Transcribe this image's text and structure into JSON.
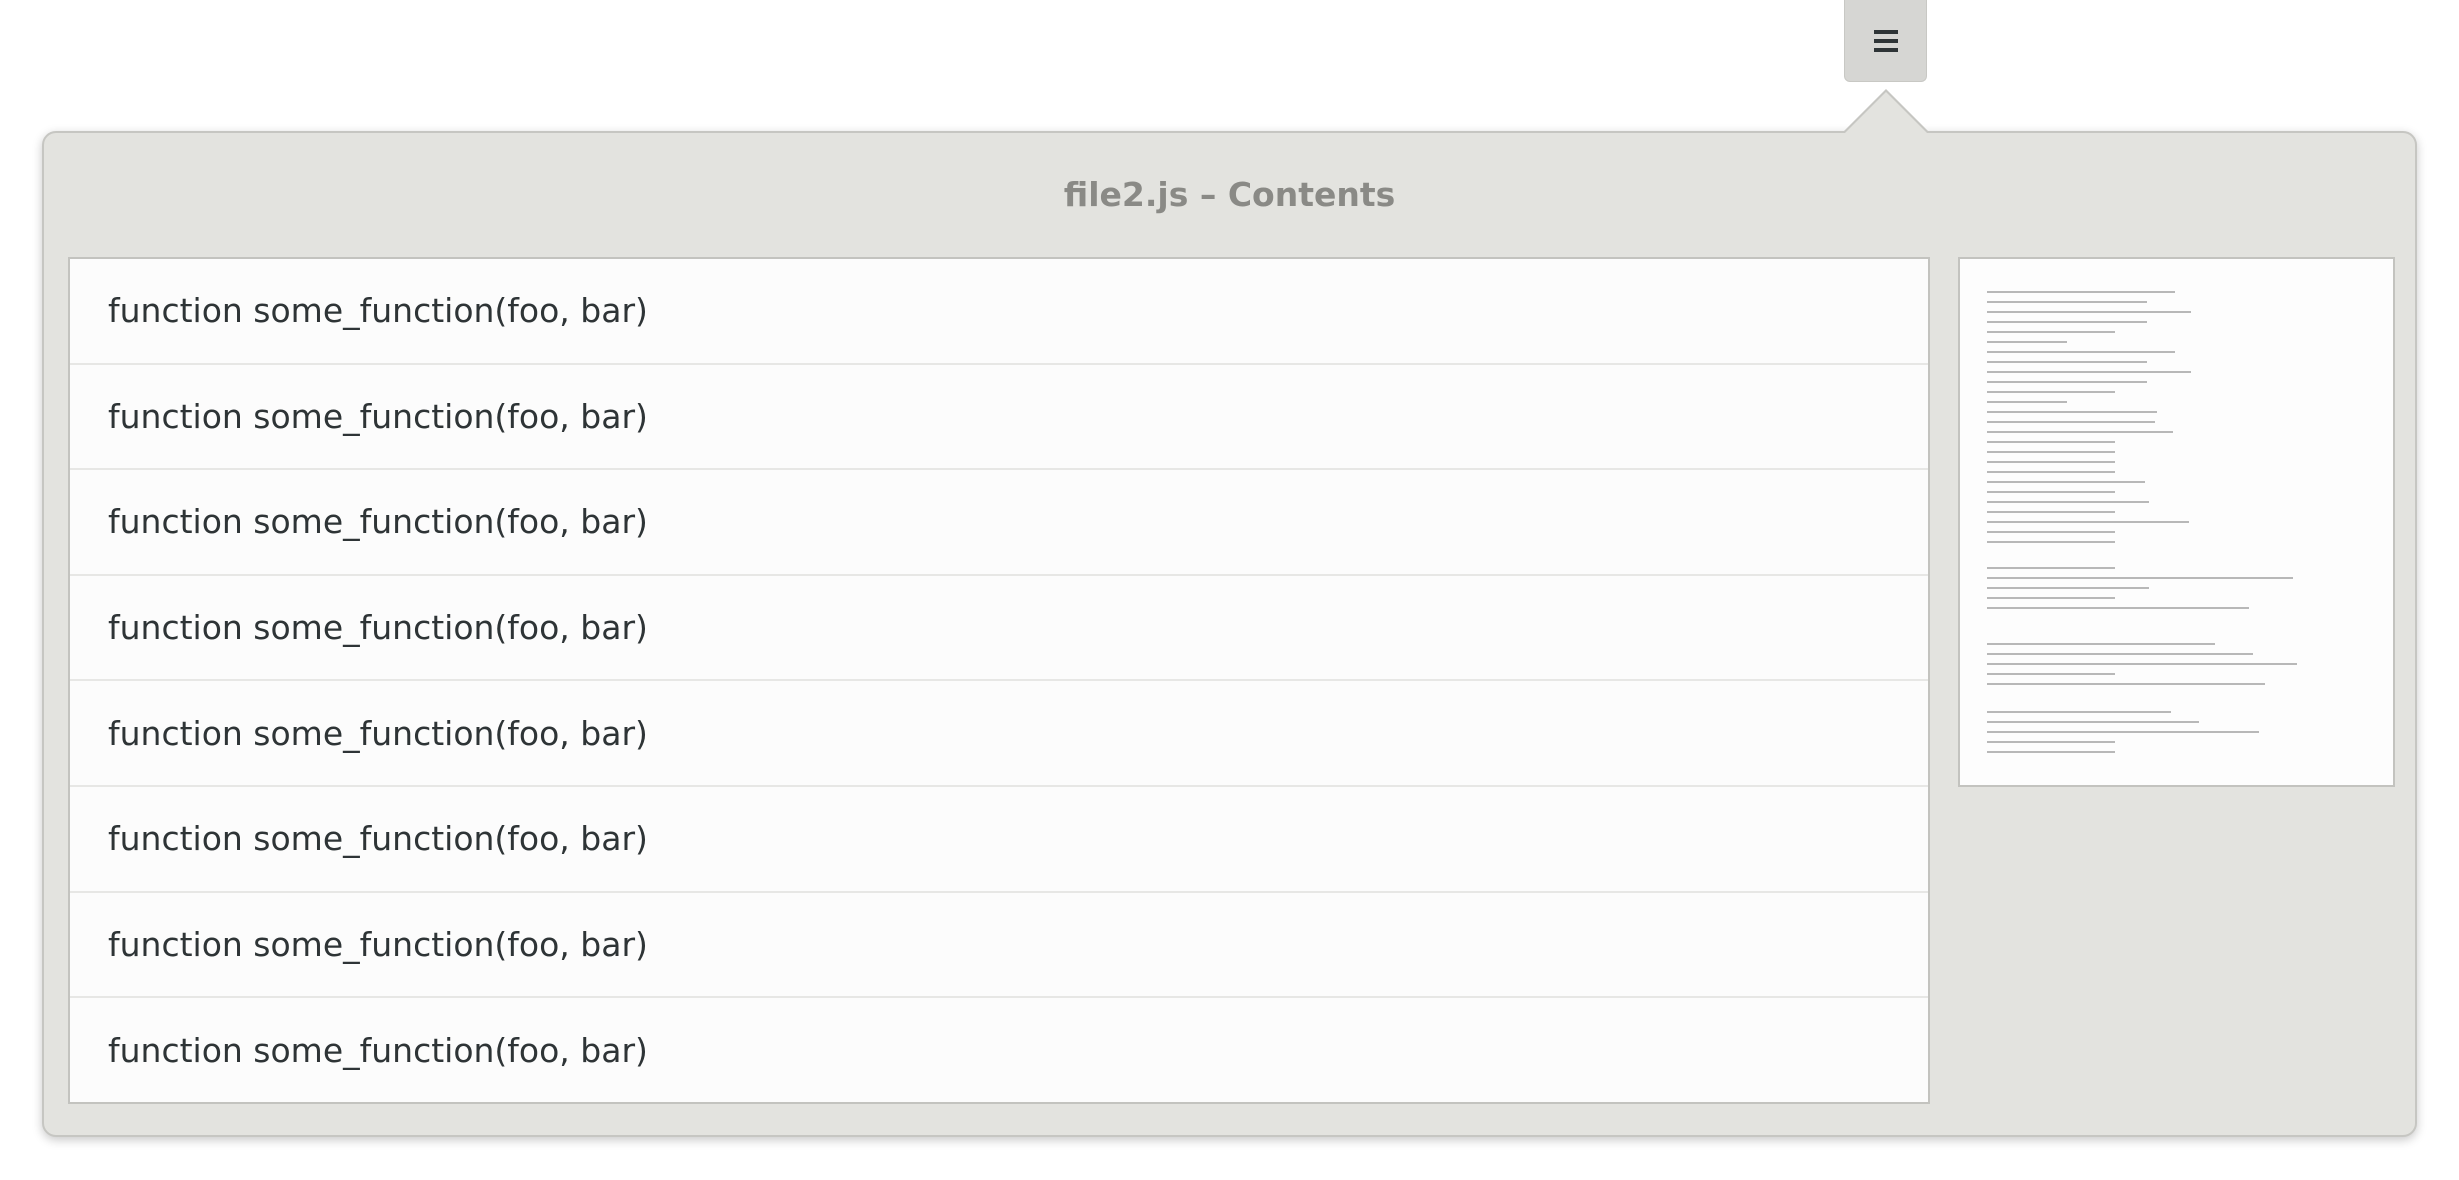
{
  "header": {
    "menu_icon": "hamburger-menu-icon"
  },
  "popover": {
    "title": "file2.js – Contents",
    "items": [
      {
        "label": "function some_function(foo, bar)"
      },
      {
        "label": "function some_function(foo, bar)"
      },
      {
        "label": "function some_function(foo, bar)"
      },
      {
        "label": "function some_function(foo, bar)"
      },
      {
        "label": "function some_function(foo, bar)"
      },
      {
        "label": "function some_function(foo, bar)"
      },
      {
        "label": "function some_function(foo, bar)"
      },
      {
        "label": "function some_function(foo, bar)"
      }
    ]
  },
  "colors": {
    "popover_bg": "#e3e3df",
    "list_bg": "#fcfcfc",
    "text": "#2e3436",
    "title": "#8a8a86",
    "minimap_line": "#b8b8b8"
  }
}
